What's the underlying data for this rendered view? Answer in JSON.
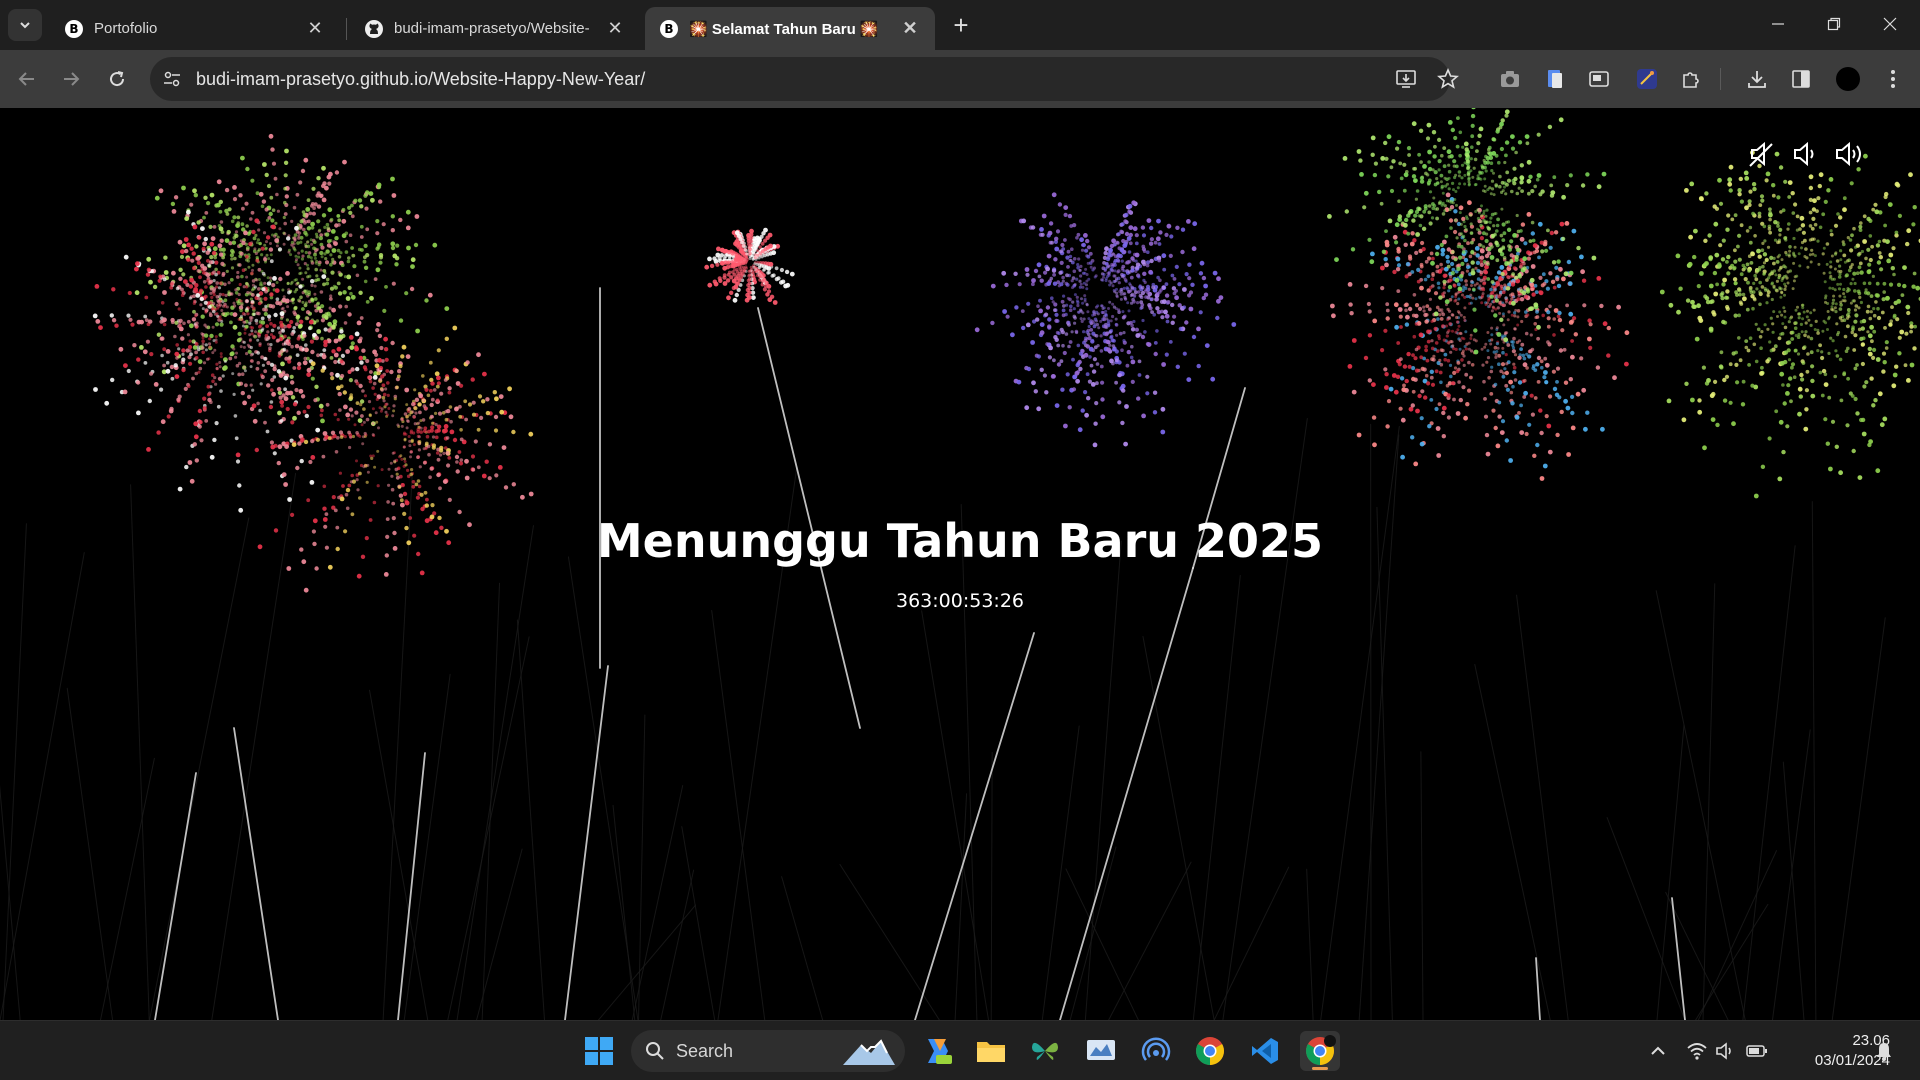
{
  "browser": {
    "tabs": [
      {
        "title": "Portofolio",
        "favicon": "b-logo-icon",
        "active": false
      },
      {
        "title": "budi-imam-prasetyo/Website-",
        "favicon": "github-icon",
        "active": false
      },
      {
        "title": "🎇 Selamat Tahun Baru 🎇",
        "favicon": "b-logo-icon",
        "active": true
      }
    ],
    "url": "budi-imam-prasetyo.github.io/Website-Happy-New-Year/"
  },
  "page": {
    "headline": "Menunggu Tahun Baru 2025",
    "countdown": "363:00:53:26",
    "sound_controls": [
      "mute-icon",
      "volume-low-icon",
      "volume-high-icon"
    ]
  },
  "taskbar": {
    "search_label": "Search",
    "clock": {
      "time": "23.06",
      "date": "03/01/2024"
    }
  },
  "colors": {
    "tabstrip": "#1f1f1f",
    "toolbar": "#3c3c3c",
    "page_bg": "#000000",
    "taskbar": "#202020",
    "firework_green": "#8fd14f",
    "firework_red": "#e8334a",
    "firework_purple": "#9a6bd8",
    "firework_pink": "#f08a9a"
  }
}
